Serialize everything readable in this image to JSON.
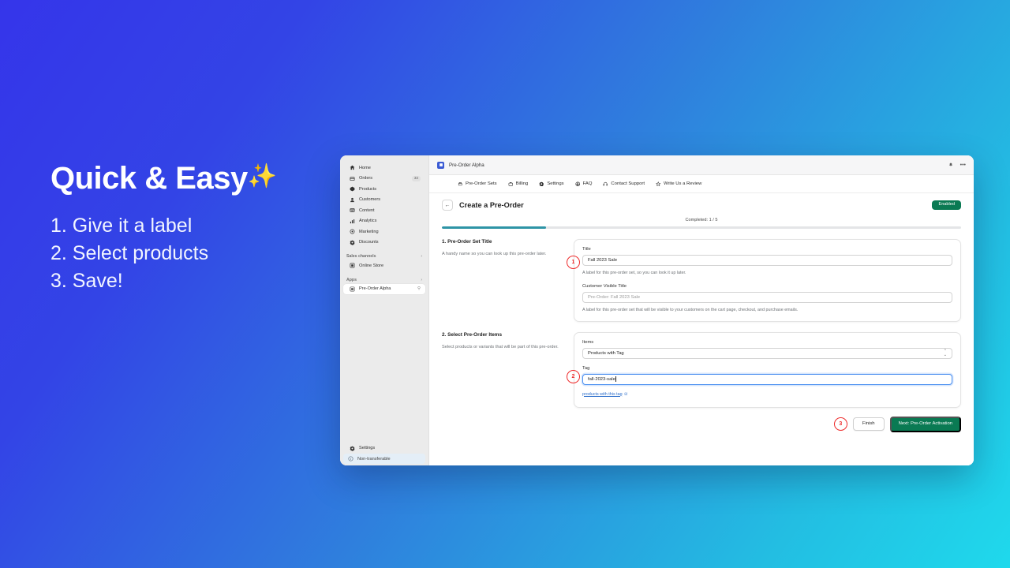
{
  "promo": {
    "title": "Quick & Easy",
    "sparkle": "✨",
    "steps": [
      "1. Give it a label",
      "2. Select products",
      "3. Save!"
    ]
  },
  "window": {
    "app_name": "Pre-Order Alpha",
    "bell_icon": "bell-icon",
    "more_icon": "more-options-icon"
  },
  "sidebar": {
    "items": [
      {
        "label": "Home",
        "icon": "home-icon",
        "badge": ""
      },
      {
        "label": "Orders",
        "icon": "orders-icon",
        "badge": "33"
      },
      {
        "label": "Products",
        "icon": "products-icon",
        "badge": ""
      },
      {
        "label": "Customers",
        "icon": "customers-icon",
        "badge": ""
      },
      {
        "label": "Content",
        "icon": "content-icon",
        "badge": ""
      },
      {
        "label": "Analytics",
        "icon": "analytics-icon",
        "badge": ""
      },
      {
        "label": "Marketing",
        "icon": "marketing-icon",
        "badge": ""
      },
      {
        "label": "Discounts",
        "icon": "discounts-icon",
        "badge": ""
      }
    ],
    "sales_channels_label": "Sales channels",
    "online_store_label": "Online Store",
    "apps_label": "Apps",
    "app_item_label": "Pre-Order Alpha",
    "settings_label": "Settings",
    "non_transferable_label": "Non-transferable"
  },
  "apptabs": [
    {
      "label": "Pre-Order Sets",
      "icon": "preorder-sets-icon"
    },
    {
      "label": "Billing",
      "icon": "billing-icon"
    },
    {
      "label": "Settings",
      "icon": "gear-icon"
    },
    {
      "label": "FAQ",
      "icon": "faq-icon"
    },
    {
      "label": "Contact Support",
      "icon": "support-icon"
    },
    {
      "label": "Write Us a Review",
      "icon": "star-icon"
    }
  ],
  "page": {
    "title": "Create a Pre-Order",
    "back_icon": "back-arrow-icon",
    "status_badge": "Enabled",
    "completed_text": "Completed: 1 / 5",
    "progress_percent": 20
  },
  "section1": {
    "marker": "1",
    "title": "1. Pre-Order Set Title",
    "description": "A handy name so you can look up this pre-order later.",
    "title_field_label": "Title",
    "title_field_value": "Fall 2023 Sale",
    "title_field_help": "A label for this pre-order set, so you can look it up later.",
    "customer_title_label": "Customer Visible Title",
    "customer_title_placeholder": "Pre-Order: Fall 2023 Sale",
    "customer_title_help": "A label for this pre-order set that will be visible to your customers on the cart page, checkout, and purchase emails."
  },
  "section2": {
    "marker": "2",
    "title": "2. Select Pre-Order Items",
    "description": "Select products or variants that will be part of this pre-order.",
    "items_label": "Items",
    "items_value": "Products with Tag",
    "tag_label": "Tag",
    "tag_value": "fall-2023-sale",
    "link_text": "products with this tag",
    "link_icon": "external-link-icon"
  },
  "actions": {
    "marker": "3",
    "finish_label": "Finish",
    "next_label": "Next: Pre-Order Activation"
  },
  "colors": {
    "accent_green": "#0a7a53",
    "progress_teal": "#2e94a6",
    "marker_red": "#ee2b2b",
    "focus_blue": "#4a8ff0",
    "link_blue": "#2c6ecb",
    "bg_gradient_start": "#3535ea",
    "bg_gradient_end": "#1fd9ec"
  }
}
